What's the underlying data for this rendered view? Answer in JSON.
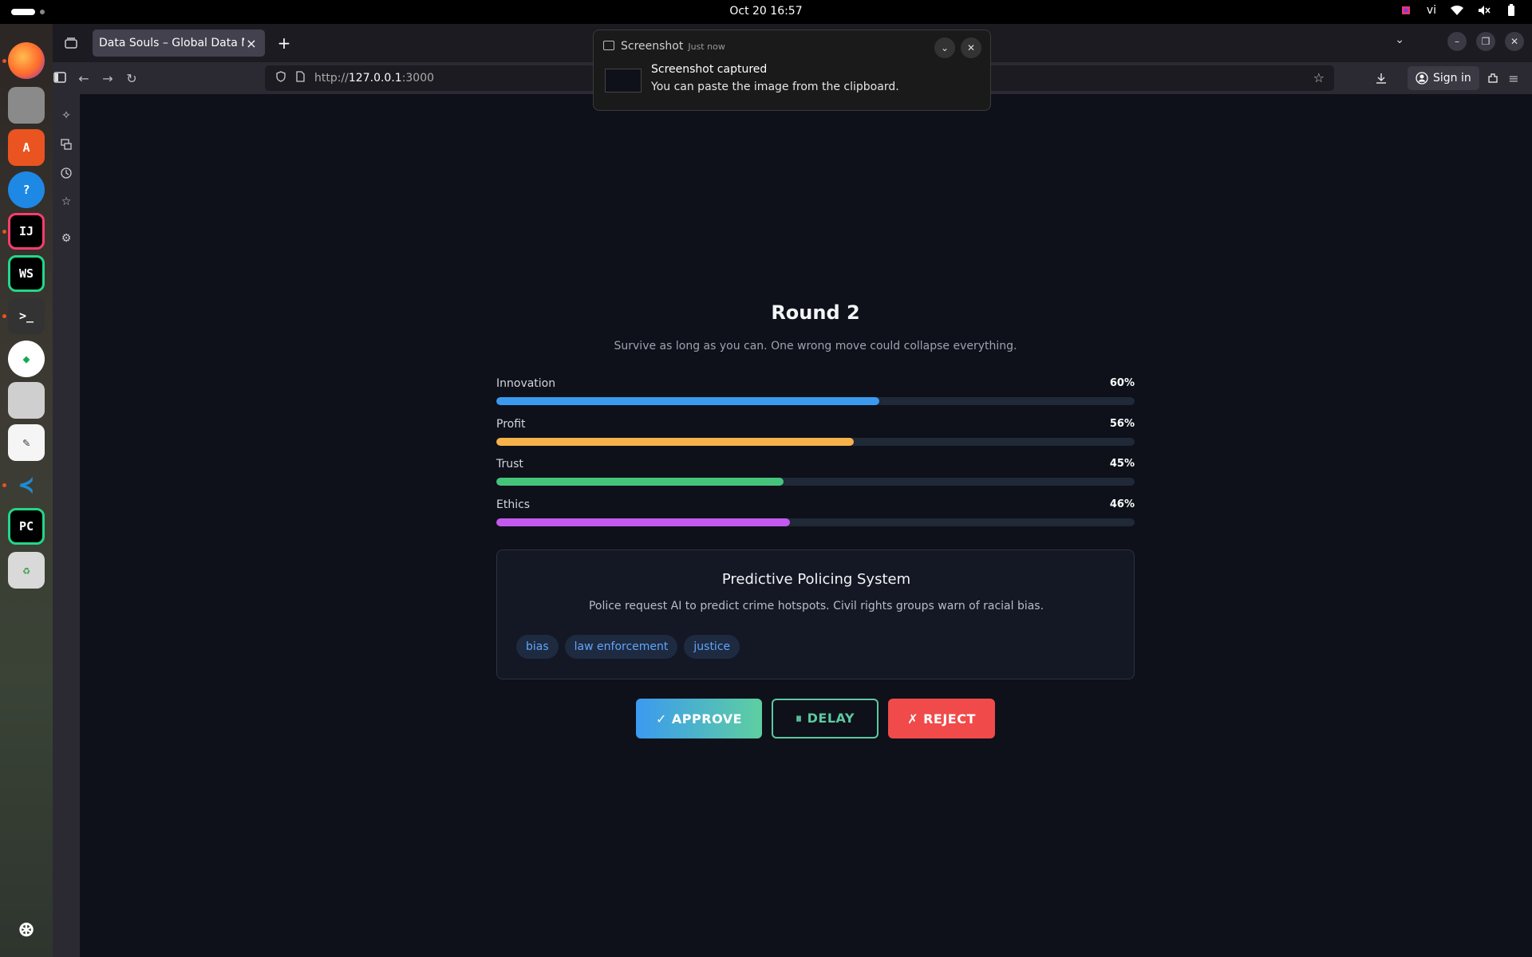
{
  "system": {
    "clock": "Oct 20  16:57",
    "input_method": "vi"
  },
  "dock": {
    "items": [
      {
        "name": "firefox",
        "label": "",
        "color": "#e66000"
      },
      {
        "name": "files",
        "label": "",
        "color": "#8a8a8a"
      },
      {
        "name": "app-center",
        "label": "A",
        "color": "#e95420"
      },
      {
        "name": "help",
        "label": "?",
        "color": "#1e88e5"
      },
      {
        "name": "intellij",
        "label": "IJ",
        "color": "#000000"
      },
      {
        "name": "webstorm",
        "label": "WS",
        "color": "#000000"
      },
      {
        "name": "terminal",
        "label": ">_",
        "color": "#333333"
      },
      {
        "name": "mongodb-compass",
        "label": "",
        "color": "#ffffff"
      },
      {
        "name": "remote-desktop",
        "label": "",
        "color": "#cfcfcf"
      },
      {
        "name": "text-editor",
        "label": "",
        "color": "#f5f5f5"
      },
      {
        "name": "vscode",
        "label": "",
        "color": "#1f8ad2"
      },
      {
        "name": "pycharm",
        "label": "PC",
        "color": "#000000"
      },
      {
        "name": "trash",
        "label": "",
        "color": "#d9d9d9"
      }
    ]
  },
  "browser": {
    "tab_title": "Data Souls – Global Data Mar",
    "url_prefix": "http://",
    "url_host": "127.0.0.1",
    "url_suffix": ":3000",
    "sign_in": "Sign in"
  },
  "notification": {
    "app": "Screenshot",
    "time": "Just now",
    "title": "Screenshot captured",
    "body": "You can paste the image from the clipboard."
  },
  "game": {
    "round_title": "Round 2",
    "subtitle": "Survive as long as you can. One wrong move could collapse everything.",
    "meters": [
      {
        "label": "Innovation",
        "value_text": "60%",
        "value": 0.6,
        "color": "#3b9af0"
      },
      {
        "label": "Profit",
        "value_text": "56%",
        "value": 0.56,
        "color": "#f6b24a"
      },
      {
        "label": "Trust",
        "value_text": "45%",
        "value": 0.45,
        "color": "#46c37b"
      },
      {
        "label": "Ethics",
        "value_text": "46%",
        "value": 0.46,
        "color": "#c459f0"
      }
    ],
    "card": {
      "title": "Predictive Policing System",
      "description": "Police request AI to predict crime hotspots. Civil rights groups warn of racial bias.",
      "tags": [
        "bias",
        "law enforcement",
        "justice"
      ]
    },
    "actions": {
      "approve": "✓ APPROVE",
      "delay": "⏸ DELAY",
      "reject": "✗ REJECT"
    }
  }
}
